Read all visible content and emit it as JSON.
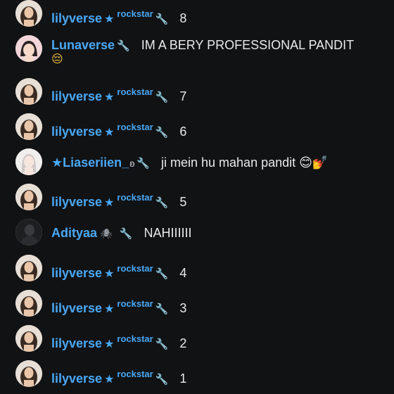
{
  "colors": {
    "background": "#111214",
    "username": "#4aa8f5",
    "text": "#e9eaec"
  },
  "messages": [
    {
      "user": "lilyverse",
      "star": "★",
      "tag": "rockstar",
      "badge": "wrench-icon",
      "text": "8"
    },
    {
      "user": "Lunaverse",
      "badge": "wrench-icon",
      "text": "IM A BERY PROFESSIONAL PANDIT",
      "emoji": "😔"
    },
    {
      "user": "lilyverse",
      "star": "★",
      "tag": "rockstar",
      "badge": "wrench-icon",
      "text": "7"
    },
    {
      "user": "lilyverse",
      "star": "★",
      "tag": "rockstar",
      "badge": "wrench-icon",
      "text": "6"
    },
    {
      "user": "★Liaseriien_",
      "extra": "ʚ",
      "badge": "wrench-icon",
      "text": "ji mein hu mahan pandit 😊💅"
    },
    {
      "user": "lilyverse",
      "star": "★",
      "tag": "rockstar",
      "badge": "wrench-icon",
      "text": "5"
    },
    {
      "user": "Adityaa",
      "extra": "🕷",
      "badge": "wrench-icon",
      "text": "NAHIIIIII"
    },
    {
      "user": "lilyverse",
      "star": "★",
      "tag": "rockstar",
      "badge": "wrench-icon",
      "text": "4"
    },
    {
      "user": "lilyverse",
      "star": "★",
      "tag": "rockstar",
      "badge": "wrench-icon",
      "text": "3"
    },
    {
      "user": "lilyverse",
      "star": "★",
      "tag": "rockstar",
      "badge": "wrench-icon",
      "text": "2"
    },
    {
      "user": "lilyverse",
      "star": "★",
      "tag": "rockstar",
      "badge": "wrench-icon",
      "text": "1"
    }
  ]
}
